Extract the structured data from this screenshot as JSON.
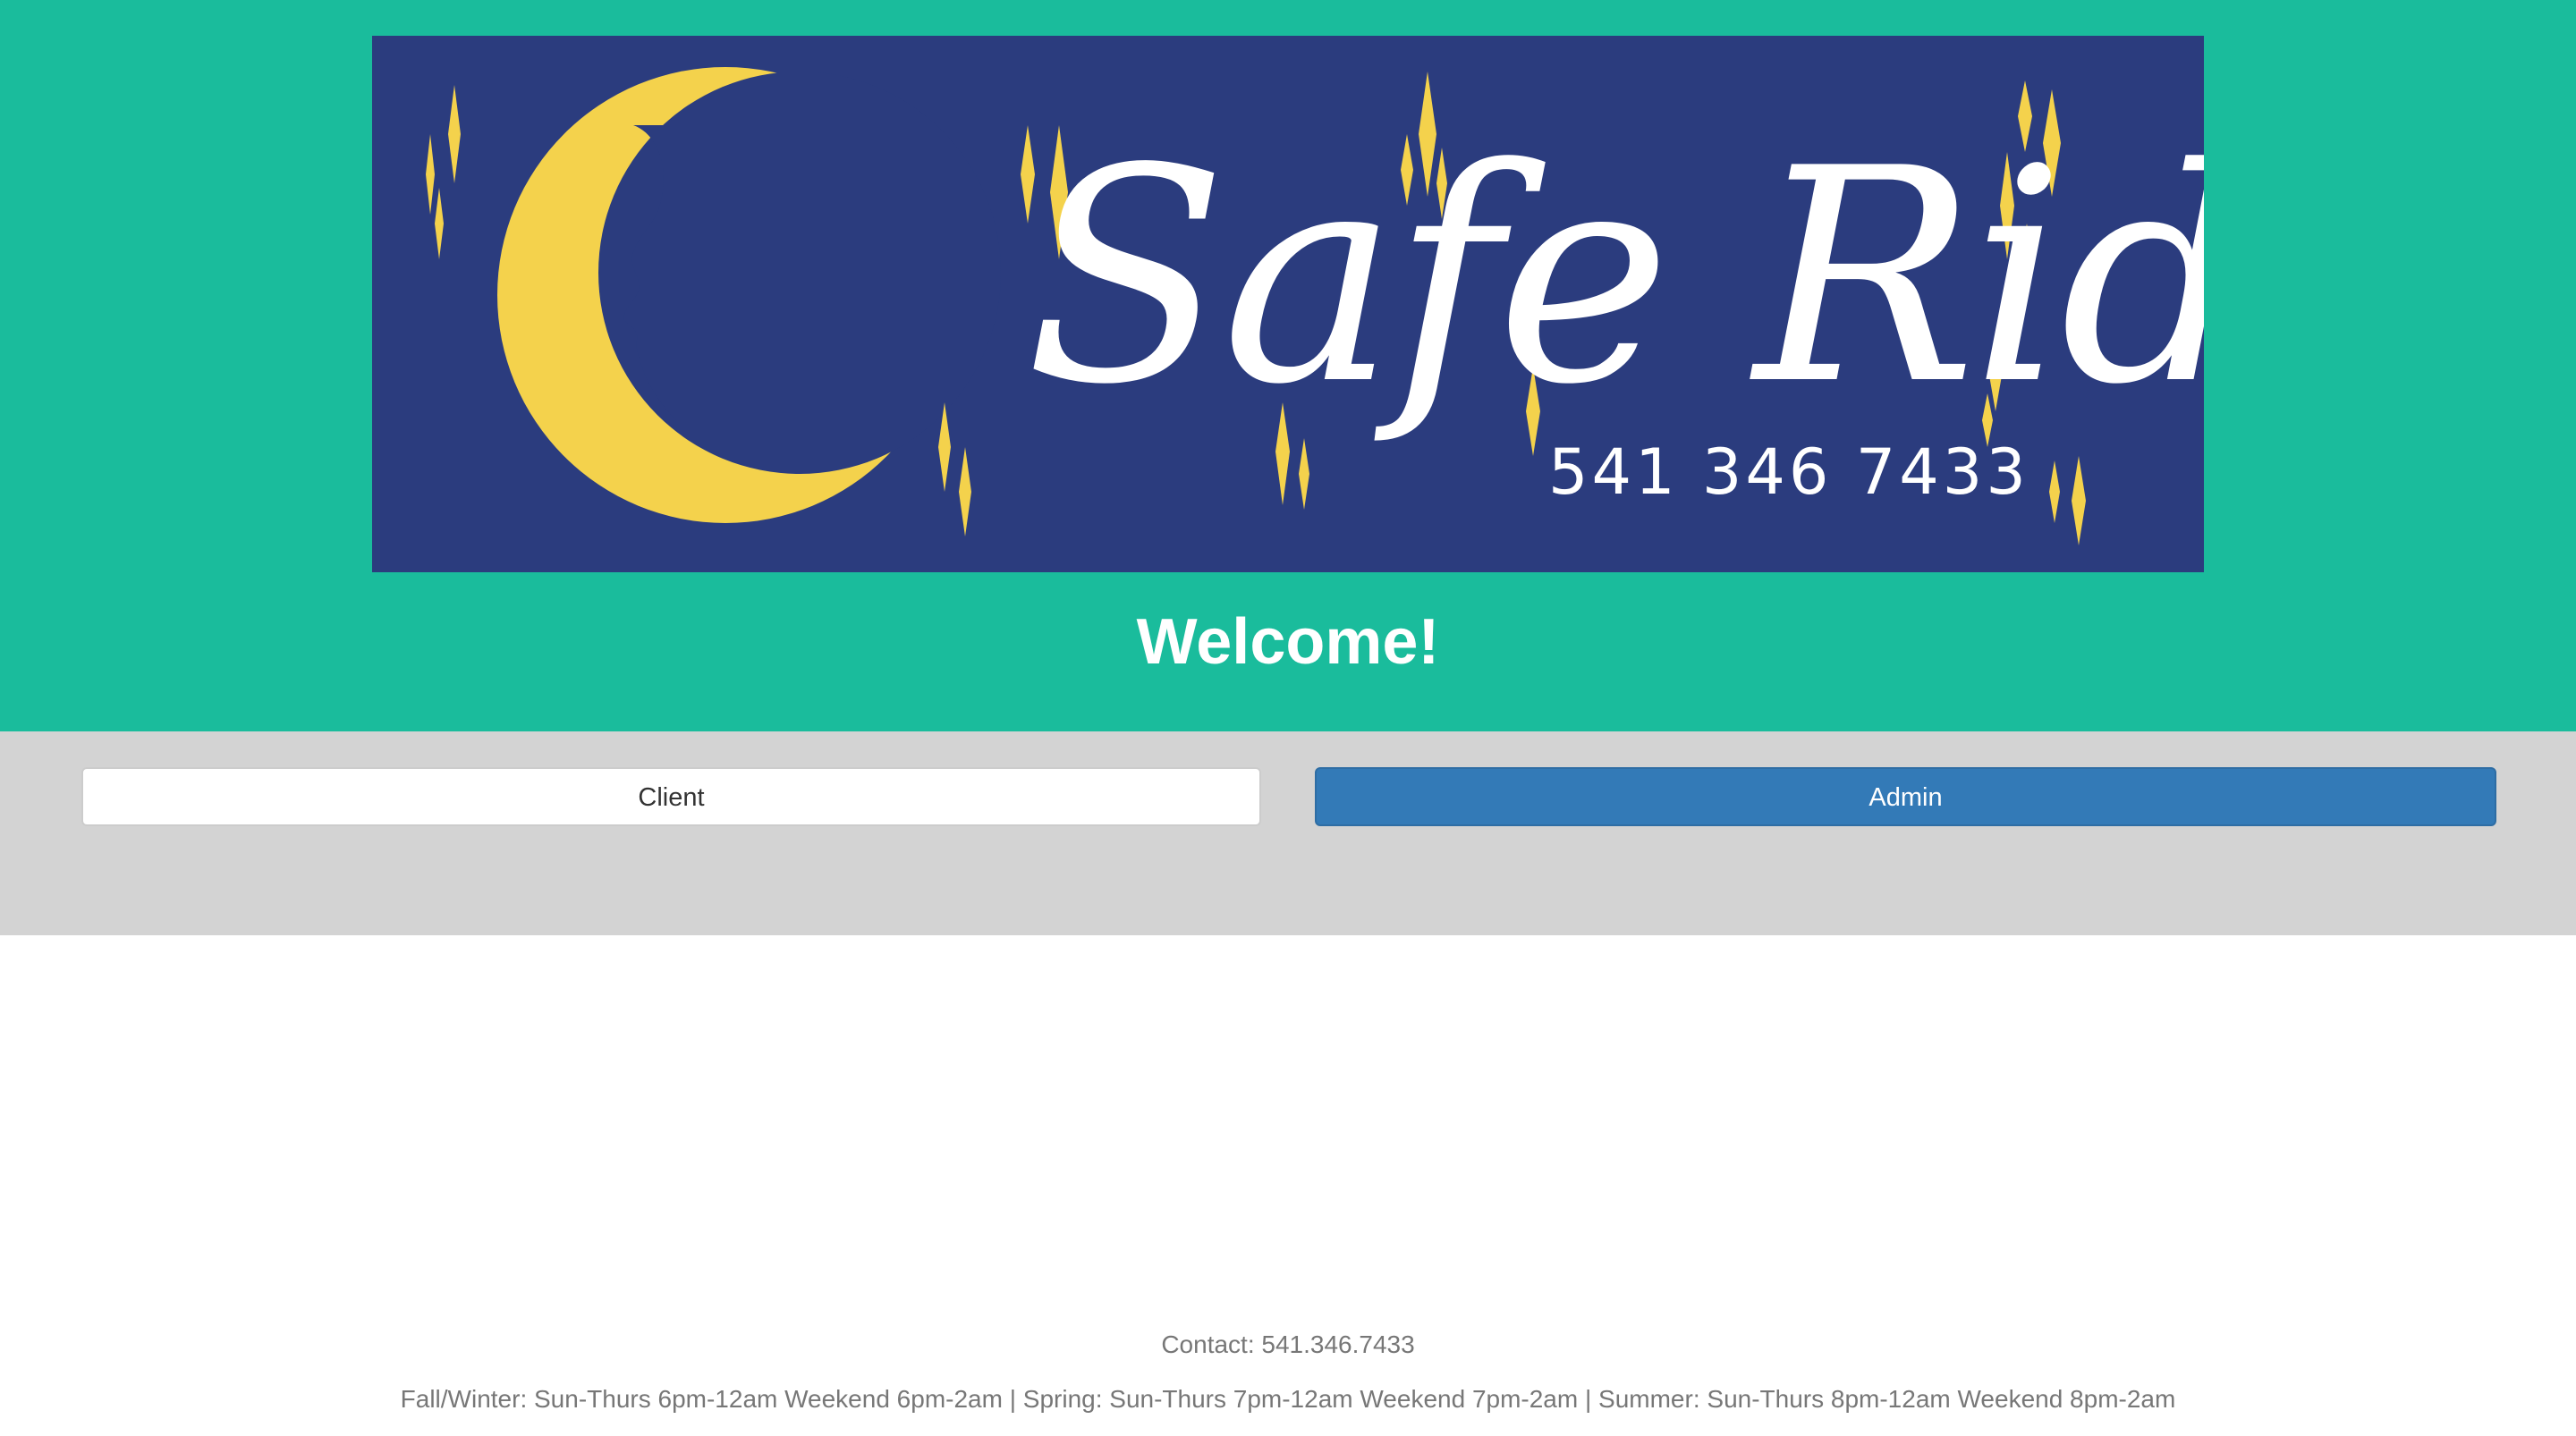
{
  "header": {
    "banner": {
      "title": "Safe Ride",
      "phone": "541 346 7433",
      "background_color": "#2b3c7e",
      "moon_color": "#f4d24c",
      "icon": "crescent-moon-icon"
    },
    "welcome_text": "Welcome!",
    "background_color": "#1abc9c"
  },
  "roles": {
    "client_label": "Client",
    "admin_label": "Admin",
    "admin_color": "#337ab7",
    "panel_color": "#d3d3d3"
  },
  "footer": {
    "contact": "Contact: 541.346.7433",
    "hours": "Fall/Winter: Sun-Thurs 6pm-12am Weekend 6pm-2am | Spring: Sun-Thurs 7pm-12am Weekend 7pm-2am | Summer: Sun-Thurs 8pm-12am Weekend 8pm-2am"
  }
}
